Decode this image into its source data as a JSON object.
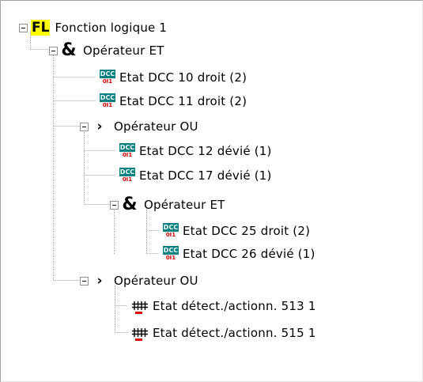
{
  "tree": {
    "root": {
      "icon": "fl-logic-icon",
      "icon_text": "FL",
      "label": "Fonction logique 1"
    },
    "nodes": [
      {
        "type": "and",
        "label": "Opérateur ET"
      },
      {
        "type": "dcc",
        "label": "Etat DCC 10 droit (2)"
      },
      {
        "type": "dcc",
        "label": "Etat DCC 11 droit (2)"
      },
      {
        "type": "or",
        "label": "Opérateur OU"
      },
      {
        "type": "dcc",
        "label": "Etat DCC 12 dévié (1)"
      },
      {
        "type": "dcc",
        "label": "Etat DCC 17 dévié (1)"
      },
      {
        "type": "and",
        "label": "Opérateur ET"
      },
      {
        "type": "dcc",
        "label": "Etat DCC 25 droit (2)"
      },
      {
        "type": "dcc",
        "label": "Etat DCC 26 dévié (1)"
      },
      {
        "type": "or",
        "label": "Opérateur OU"
      },
      {
        "type": "detector",
        "label": "Etat détect./actionn.  513 1"
      },
      {
        "type": "detector",
        "label": "Etat détect./actionn.  515 1"
      }
    ]
  },
  "icons": {
    "dcc_top": "DCC",
    "dcc_bottom": "0I1",
    "and_symbol": "&",
    "or_symbol": "›"
  },
  "colors": {
    "fl_background": "#ffff00",
    "dcc_teal": "#008080",
    "dcc_red": "#cc0000"
  }
}
